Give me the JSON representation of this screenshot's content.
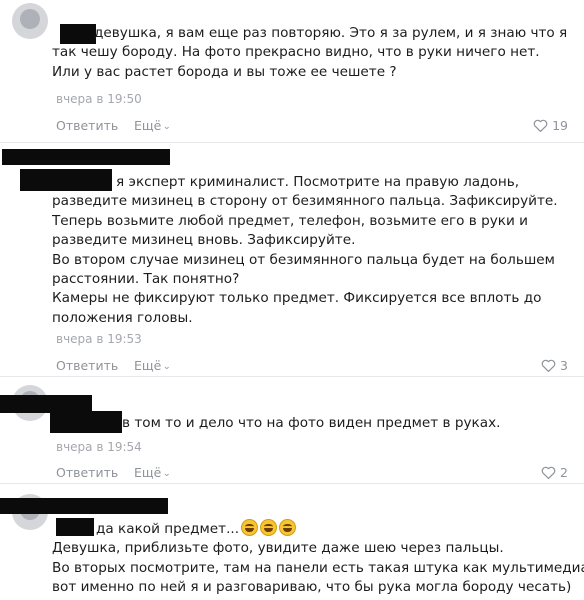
{
  "comments": [
    {
      "lines": [
        "девушка, я вам еще раз повторяю. Это я за рулем, и я знаю что я",
        "так чешу бороду. На фото прекрасно видно, что в руки ничего нет.",
        "Или у вас растет борода и вы тоже ее чешете ?"
      ],
      "time": "вчера в 19:50",
      "reply": "Ответить",
      "more": "Ещё",
      "likes": "19"
    },
    {
      "lines": [
        "я эксперт криминалист. Посмотрите на правую ладонь,",
        "разведите мизинец в сторону от безимянного пальца. Зафиксируйте.",
        "Теперь возьмите любой предмет, телефон, возьмите его в руки и",
        "разведите мизинец вновь. Зафиксируйте.",
        "Во втором случае мизинец от безимянного пальца будет на большем",
        "расстоянии. Так понятно?",
        "Камеры не фиксируют только предмет. Фиксируется все вплоть до",
        "положения головы."
      ],
      "time": "вчера в 19:53",
      "reply": "Ответить",
      "more": "Ещё",
      "likes": "3"
    },
    {
      "lines": [
        "в том то и дело что на фото виден предмет в руках."
      ],
      "time": "вчера в 19:54",
      "reply": "Ответить",
      "more": "Ещё",
      "likes": "2"
    },
    {
      "lines": [
        "да какой предмет...",
        "Девушка, приблизьте фото, увидите даже шею через пальцы.",
        "Во вторых посмотрите, там на панели есть такая штука как мультимедиа,",
        "вот именно по ней я и разговариваю, что бы рука могла бороду чесать)"
      ],
      "emoji": "rolling-on-floor-laughing-emoji"
    }
  ],
  "icons": {
    "like": "heart-outline-icon",
    "more": "chevron-down-icon"
  },
  "colors": {
    "meta": "#a4a8ae",
    "action": "#8f949a",
    "redaction": "#0b0b0b"
  }
}
